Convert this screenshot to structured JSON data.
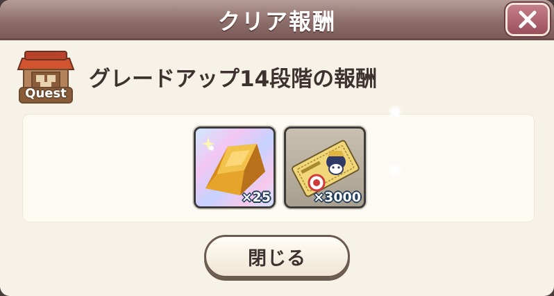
{
  "dialog": {
    "title": "クリア報酬",
    "close_icon": "close-x-icon"
  },
  "quest": {
    "icon": "quest-shop-icon",
    "label": "Quest",
    "reward_title": "グレードアップ14段階の報酬"
  },
  "rewards": [
    {
      "icon": "gold-bar-icon",
      "count": "×25"
    },
    {
      "icon": "ticket-icon",
      "count": "×3000"
    }
  ],
  "footer": {
    "close_label": "閉じる"
  },
  "colors": {
    "title_bar": "#8e6e6a",
    "close_button": "#9b4f5c",
    "background": "#f7f2e8",
    "text": "#3d3230"
  }
}
